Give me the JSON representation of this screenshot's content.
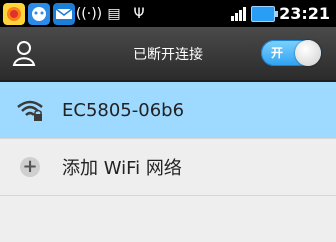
{
  "statusbar": {
    "time": "23:21",
    "icons": [
      "app-icon-colorful",
      "chat-icon",
      "mail-icon",
      "wifi-hotspot-icon",
      "android-icon",
      "usb-icon",
      "signal-icon",
      "battery-charging-icon"
    ]
  },
  "header": {
    "title": "已断开连接",
    "toggle_label": "开",
    "toggle_on": true
  },
  "networks": [
    {
      "ssid": "EC5805-06b6",
      "icon": "wifi-lock-icon",
      "selected": true
    },
    {
      "ssid": "添加 WiFi 网络",
      "icon": "plus-icon",
      "selected": false
    }
  ],
  "colors": {
    "accent": "#2ea2f2",
    "selected_row": "#9ed9ff",
    "header": "#2b2b2b"
  }
}
